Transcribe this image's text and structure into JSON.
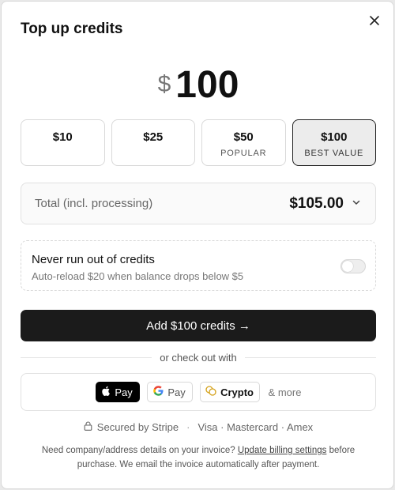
{
  "dialog": {
    "title": "Top up credits",
    "close_icon": "close-icon"
  },
  "amount": {
    "currency_symbol": "$",
    "value": "100"
  },
  "presets": [
    {
      "value": "$10",
      "tag": "",
      "selected": false
    },
    {
      "value": "$25",
      "tag": "",
      "selected": false
    },
    {
      "value": "$50",
      "tag": "POPULAR",
      "selected": false
    },
    {
      "value": "$100",
      "tag": "BEST VALUE",
      "selected": true
    }
  ],
  "total": {
    "label": "Total (incl. processing)",
    "value": "$105.00",
    "icon": "chevron-down-icon"
  },
  "auto_reload": {
    "title": "Never run out of credits",
    "subtitle": "Auto-reload $20 when balance drops below $5",
    "enabled": false
  },
  "cta": {
    "label": "Add $100 credits →"
  },
  "checkout": {
    "divider_text": "or check out with",
    "apple_pay_label": "Pay",
    "google_pay_label": "Pay",
    "crypto_label": "Crypto",
    "more_label": "& more"
  },
  "secured": {
    "label": "Secured by Stripe",
    "separator": "·",
    "cards": "Visa · Mastercard · Amex"
  },
  "footnote": {
    "prefix": "Need company/address details on your invoice?",
    "link": "Update billing settings",
    "suffix": "before purchase. We email the invoice automatically after payment."
  },
  "colors": {
    "primary_button": "#1b1b1b",
    "selected_preset_bg": "#ececec",
    "muted_text": "#777777"
  }
}
